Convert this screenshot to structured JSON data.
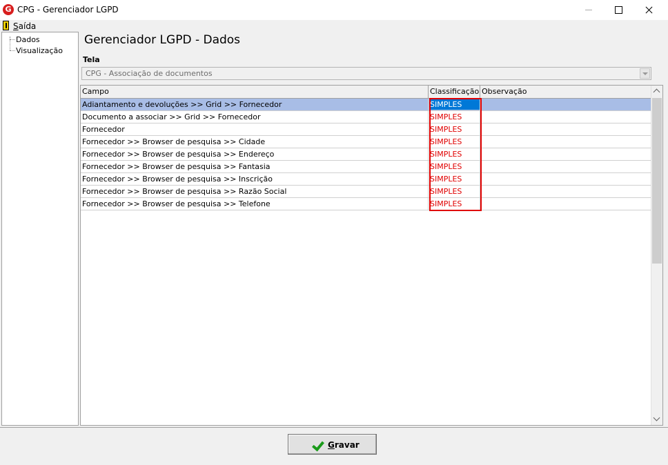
{
  "window": {
    "title": "CPG - Gerenciador LGPD",
    "icon_letter": "G"
  },
  "menu": {
    "saida_label": "Saída"
  },
  "tree": {
    "items": [
      "Dados",
      "Visualização"
    ]
  },
  "page": {
    "title": "Gerenciador LGPD - Dados"
  },
  "tela": {
    "label": "Tela",
    "selected": "CPG - Associação de documentos"
  },
  "grid": {
    "columns": [
      "Campo",
      "Classificação",
      "Observação"
    ],
    "rows": [
      {
        "campo": "Adiantamento e devoluções >> Grid >> Fornecedor",
        "classificacao": "SIMPLES",
        "observacao": ""
      },
      {
        "campo": "Documento a associar >> Grid >> Fornecedor",
        "classificacao": "SIMPLES",
        "observacao": ""
      },
      {
        "campo": "Fornecedor",
        "classificacao": "SIMPLES",
        "observacao": ""
      },
      {
        "campo": "Fornecedor >> Browser de pesquisa >> Cidade",
        "classificacao": "SIMPLES",
        "observacao": ""
      },
      {
        "campo": "Fornecedor >> Browser de pesquisa >> Endereço",
        "classificacao": "SIMPLES",
        "observacao": ""
      },
      {
        "campo": "Fornecedor >> Browser de pesquisa >> Fantasia",
        "classificacao": "SIMPLES",
        "observacao": ""
      },
      {
        "campo": "Fornecedor >> Browser de pesquisa >> Inscrição",
        "classificacao": "SIMPLES",
        "observacao": ""
      },
      {
        "campo": "Fornecedor >> Browser de pesquisa >> Razão Social",
        "classificacao": "SIMPLES",
        "observacao": ""
      },
      {
        "campo": "Fornecedor >> Browser de pesquisa >> Telefone",
        "classificacao": "SIMPLES",
        "observacao": ""
      }
    ]
  },
  "actions": {
    "gravar_label": "Gravar"
  },
  "colors": {
    "highlight": "#e00000",
    "selected_row": "#a8bde6",
    "selected_cell": "#0078d7",
    "classification_text": "#e00000"
  }
}
